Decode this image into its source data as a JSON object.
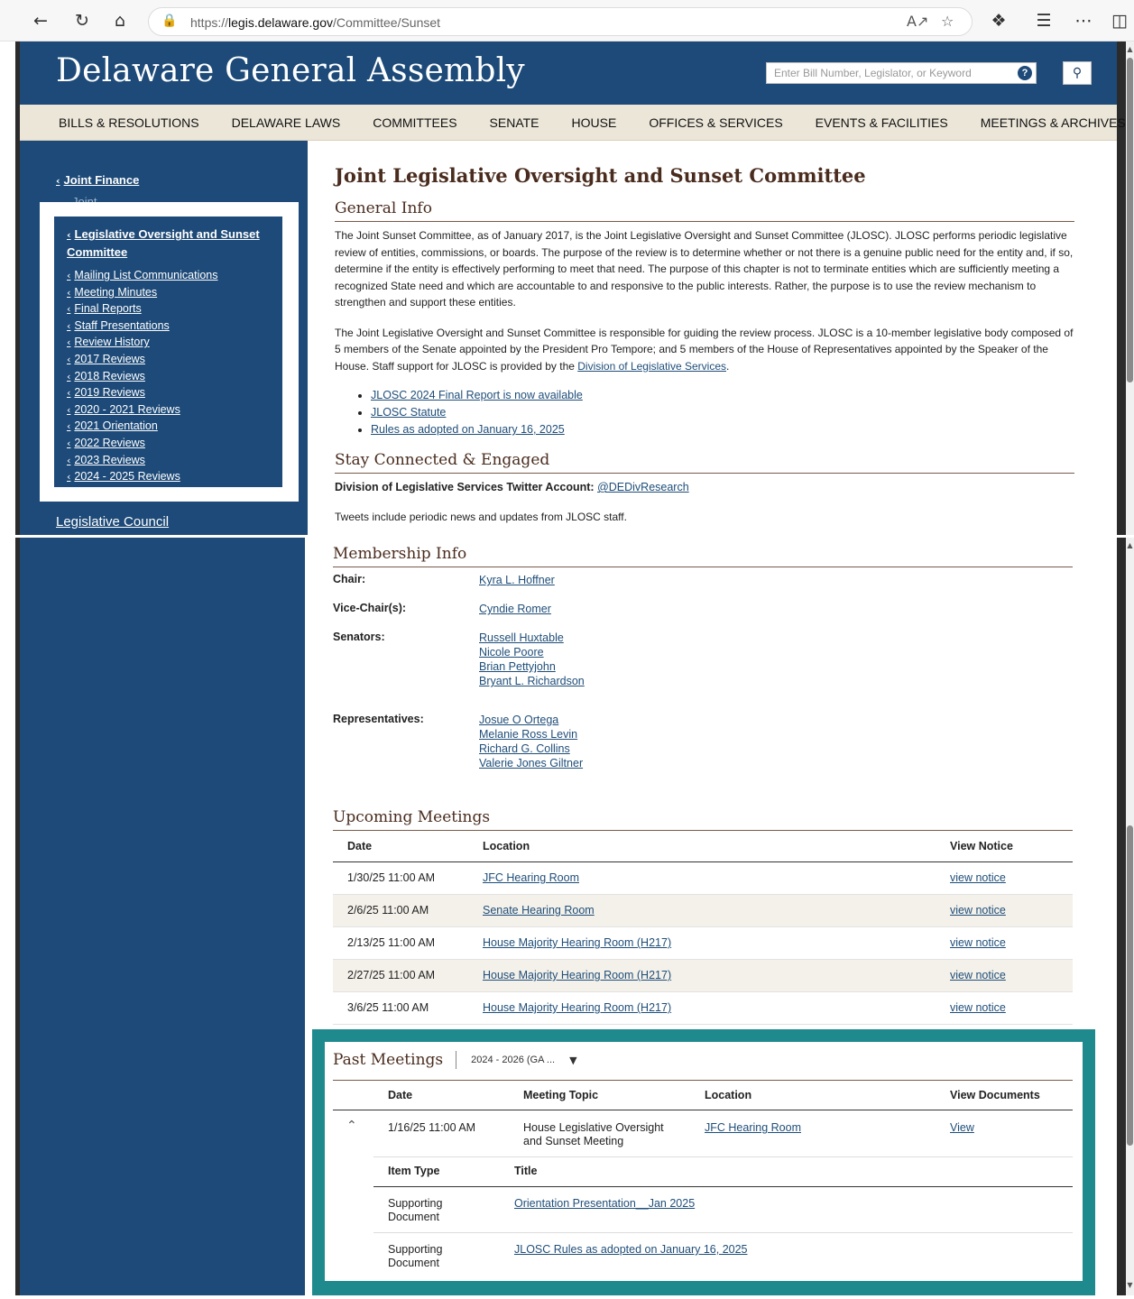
{
  "browser": {
    "url_prefix": "https://",
    "url_host": "legis.delaware.gov",
    "url_path": "/Committee/Sunset",
    "icons": [
      "back-arrow-icon",
      "refresh-icon",
      "home-icon",
      "lock-icon",
      "read-aloud-icon",
      "favorite-star-icon",
      "extensions-icon",
      "favorites-icon",
      "more-icon",
      "sidebar-icon"
    ]
  },
  "header": {
    "site_title": "Delaware General Assembly",
    "search_placeholder": "Enter Bill Number, Legislator, or Keyword",
    "help_glyph": "?"
  },
  "nav": {
    "items": [
      "BILLS & RESOLUTIONS",
      "DELAWARE LAWS",
      "COMMITTEES",
      "SENATE",
      "HOUSE",
      "OFFICES & SERVICES",
      "EVENTS & FACILITIES",
      "MEETINGS & ARCHIVES"
    ]
  },
  "sidebar": {
    "back_link": "Joint Finance",
    "peek_text": "Joint ...",
    "active_title": "Legislative Oversight and Sunset Committee",
    "sub_links": [
      "Mailing List Communications",
      "Meeting Minutes",
      "Final Reports",
      "Staff Presentations",
      "Review History",
      "2017 Reviews",
      "2018 Reviews",
      "2019 Reviews",
      "2020 - 2021 Reviews",
      "2021 Orientation",
      "2022 Reviews",
      "2023 Reviews",
      "2024 - 2025 Reviews"
    ],
    "next_link": "Legislative Council"
  },
  "main": {
    "title": "Joint Legislative Oversight and Sunset Committee",
    "general_heading": "General Info",
    "para1": "The Joint Sunset Committee, as of January 2017, is the Joint Legislative Oversight and Sunset Committee (JLOSC). JLOSC performs periodic legislative review of entities, commissions, or boards. The purpose of the review is to determine whether or not there is a genuine public need for the entity and, if so, determine if the entity is effectively performing to meet that need. The purpose of this chapter is not to terminate entities which are sufficiently meeting a recognized State need and which are accountable to and responsive to the public interests. Rather, the purpose is to use the review mechanism to strengthen and support these entities.",
    "para2_text": "The Joint Legislative Oversight and Sunset Committee is responsible for guiding the review process. JLOSC is a 10-member legislative body composed of 5 members of the Senate appointed by the President Pro Tempore; and 5 members of the House of Representatives appointed by the Speaker of the House. Staff support for JLOSC is provided by the ",
    "para2_link": "Division of Legislative Services",
    "para2_end": ".",
    "bullets": [
      "JLOSC 2024 Final Report is now available",
      "JLOSC Statute",
      "Rules as adopted on January 16, 2025"
    ],
    "stay_heading": "Stay Connected & Engaged",
    "twitter_label": "Division of Legislative Services Twitter Account:",
    "twitter_handle": "@DEDivResearch",
    "tweets_note": "Tweets include periodic news and updates from JLOSC staff."
  },
  "membership": {
    "heading": "Membership Info",
    "chair_label": "Chair:",
    "chair": [
      "Kyra L. Hoffner"
    ],
    "vice_label": "Vice-Chair(s):",
    "vice": [
      "Cyndie Romer"
    ],
    "senators_label": "Senators:",
    "senators": [
      "Russell Huxtable",
      "Nicole Poore",
      "Brian Pettyjohn",
      "Bryant L. Richardson"
    ],
    "reps_label": "Representatives:",
    "reps": [
      "Josue O Ortega",
      "Melanie Ross Levin",
      "Richard G. Collins",
      "Valerie Jones Giltner"
    ]
  },
  "upcoming": {
    "heading": "Upcoming Meetings",
    "columns": [
      "Date",
      "Location",
      "View Notice"
    ],
    "rows": [
      {
        "date": "1/30/25 11:00 AM",
        "location": "JFC Hearing Room",
        "notice": "view notice"
      },
      {
        "date": "2/6/25 11:00 AM",
        "location": "Senate Hearing Room",
        "notice": "view notice"
      },
      {
        "date": "2/13/25 11:00 AM",
        "location": "House Majority Hearing Room (H217)",
        "notice": "view notice"
      },
      {
        "date": "2/27/25 11:00 AM",
        "location": "House Majority Hearing Room (H217)",
        "notice": "view notice"
      },
      {
        "date": "3/6/25 11:00 AM",
        "location": "House Majority Hearing Room (H217)",
        "notice": "view notice"
      }
    ]
  },
  "past": {
    "heading": "Past Meetings",
    "session_select": "2024 - 2026 (GA ...",
    "columns": [
      "Date",
      "Meeting Topic",
      "Location",
      "View Documents"
    ],
    "meeting": {
      "date": "1/16/25 11:00 AM",
      "topic_line1": "House Legislative Oversight",
      "topic_line2": "and Sunset Meeting",
      "location": "JFC Hearing Room",
      "view": "View"
    },
    "doc_columns": [
      "Item Type",
      "Title"
    ],
    "docs": [
      {
        "type_line1": "Supporting",
        "type_line2": "Document",
        "title": "Orientation Presentation__Jan 2025"
      },
      {
        "type_line1": "Supporting",
        "type_line2": "Document",
        "title": "JLOSC Rules as adopted on January 16, 2025"
      }
    ]
  },
  "colors": {
    "header_blue": "#1d4a78",
    "nav_beige": "#ece6d9",
    "heading_brown": "#4a2c1e",
    "teal": "#1e8a8e",
    "link": "#1f4e79"
  }
}
